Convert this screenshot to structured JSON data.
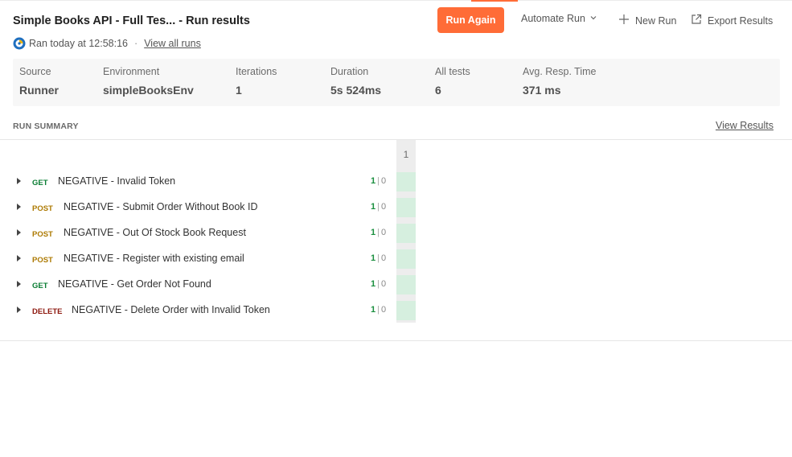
{
  "header": {
    "title": "Simple Books API - Full Tes... - Run results",
    "ran_text": "Ran today at 12:58:16",
    "separator": "·",
    "view_all_runs": "View all runs"
  },
  "actions": {
    "run_again": "Run Again",
    "automate_run": "Automate Run",
    "new_run": "New Run",
    "export_results": "Export Results"
  },
  "meta": [
    {
      "label": "Source",
      "value": "Runner"
    },
    {
      "label": "Environment",
      "value": "simpleBooksEnv"
    },
    {
      "label": "Iterations",
      "value": "1"
    },
    {
      "label": "Duration",
      "value": "5s 524ms"
    },
    {
      "label": "All tests",
      "value": "6"
    },
    {
      "label": "Avg. Resp. Time",
      "value": "371 ms"
    }
  ],
  "summary": {
    "heading": "RUN SUMMARY",
    "view_results": "View Results",
    "iteration_header": "1",
    "requests": [
      {
        "method": "GET",
        "name": "NEGATIVE - Invalid Token",
        "passed": "1",
        "failed": "0"
      },
      {
        "method": "POST",
        "name": "NEGATIVE - Submit Order Without Book ID",
        "passed": "1",
        "failed": "0"
      },
      {
        "method": "POST",
        "name": "NEGATIVE - Out Of Stock Book Request",
        "passed": "1",
        "failed": "0"
      },
      {
        "method": "POST",
        "name": "NEGATIVE - Register with existing email",
        "passed": "1",
        "failed": "0"
      },
      {
        "method": "GET",
        "name": "NEGATIVE - Get Order Not Found",
        "passed": "1",
        "failed": "0"
      },
      {
        "method": "DELETE",
        "name": "NEGATIVE - Delete Order with Invalid Token",
        "passed": "1",
        "failed": "0"
      }
    ]
  },
  "colors": {
    "accent": "#ff6c37",
    "get": "#0a7d33",
    "post": "#ad7a03",
    "delete": "#8e1a10",
    "pass_cell": "#d6efdf"
  }
}
